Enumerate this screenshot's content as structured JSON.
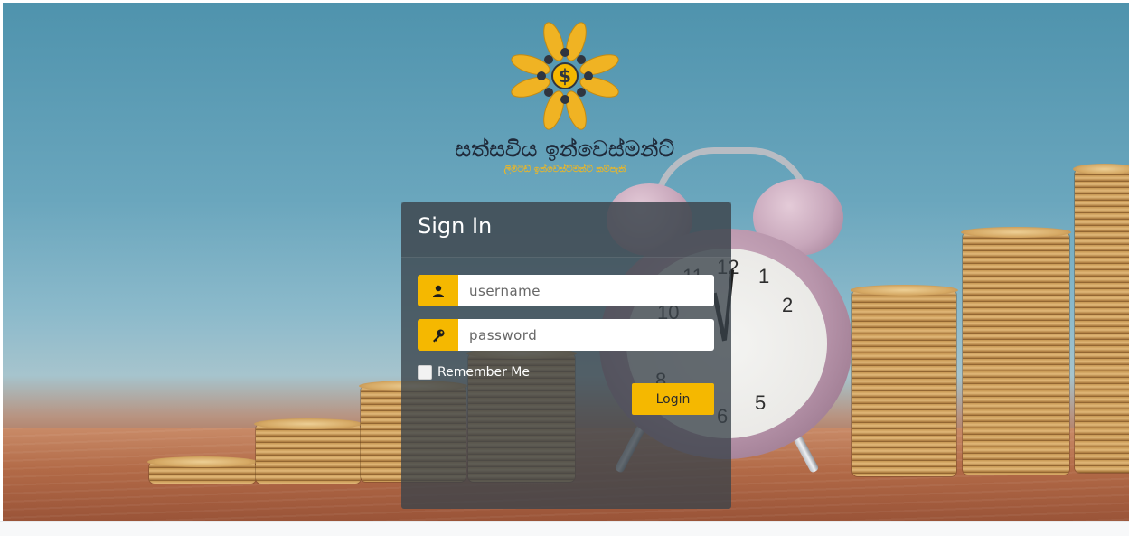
{
  "brand": {
    "title": "සත්සවිය ඉන්වෙස්මන්ට්",
    "subtitle": "ලිමිටඩ් ඉන්වෙස්ට්මන්ට් කම්පැනි",
    "logo_icon": "dollar-sun-logo",
    "accent_color": "#f5b800"
  },
  "login": {
    "title": "Sign In",
    "username_placeholder": "username",
    "password_placeholder": "password",
    "username_icon": "user-icon",
    "password_icon": "key-icon",
    "remember_label": "Remember Me",
    "remember_checked": false,
    "login_label": "Login"
  },
  "background": {
    "clock_numbers": [
      "11",
      "12",
      "1",
      "2",
      "10",
      "8",
      "5",
      "6"
    ]
  }
}
